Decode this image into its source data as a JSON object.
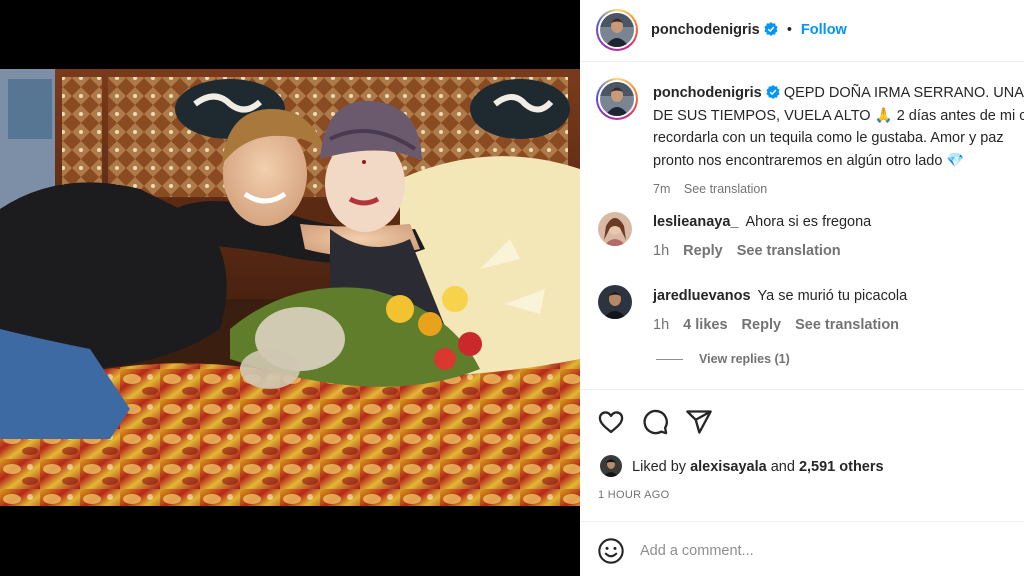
{
  "post": {
    "author": "ponchodenigris",
    "follow_label": "Follow",
    "separator": "•",
    "caption_line1": "QEPD DOÑA IRMA SERRANO. UNA",
    "caption_line2": "DE SUS TIEMPOS, VUELA ALTO 🙏 2 días antes de mi c",
    "caption_line3": "recordarla con un tequila como le gustaba. Amor y paz",
    "caption_line4": "pronto nos encontraremos en algún otro lado 💎",
    "caption_time": "7m",
    "see_translation": "See translation"
  },
  "comments": [
    {
      "user": "leslieanaya_",
      "text": "Ahora si es fregona",
      "time": "1h",
      "likes": "",
      "reply": "Reply",
      "translate": "See translation"
    },
    {
      "user": "jaredluevanos",
      "text": "Ya se murió tu picacola",
      "time": "1h",
      "likes": "4 likes",
      "reply": "Reply",
      "translate": "See translation"
    }
  ],
  "view_replies": "View replies (1)",
  "likes": {
    "prefix": "Liked by",
    "user": "alexisayala",
    "and": "and",
    "others": "2,591 others"
  },
  "timestamp": "1 HOUR AGO",
  "comment_box": {
    "placeholder": "Add a comment..."
  },
  "icons": {
    "like": "heart-icon",
    "comment": "comment-icon",
    "share": "share-icon",
    "emoji": "emoji-icon",
    "verified": "verified-badge-icon"
  },
  "colors": {
    "accent": "#0095f6",
    "text": "#262626",
    "muted": "#737373"
  }
}
